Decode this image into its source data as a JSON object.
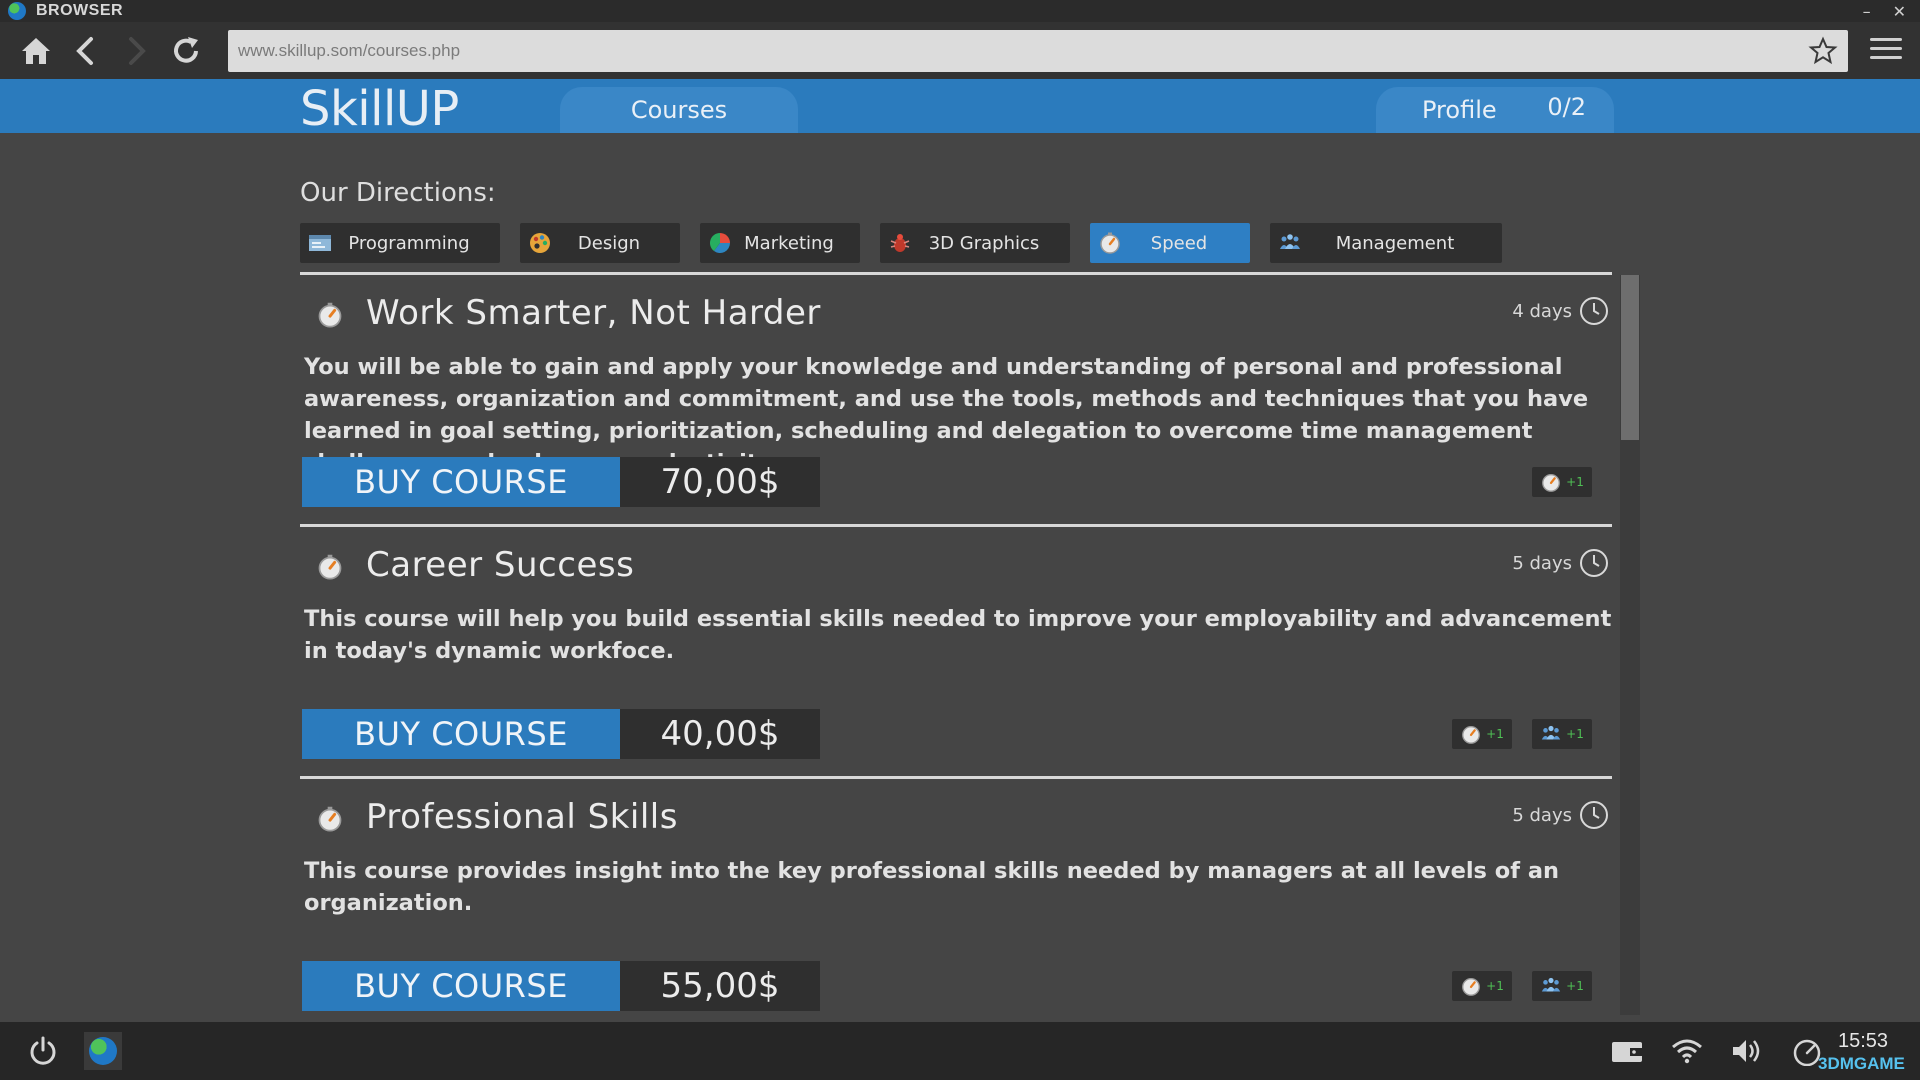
{
  "window": {
    "title": "BROWSER",
    "minimize": "–",
    "close": "✕"
  },
  "browser": {
    "url": "www.skillup.som/courses.php"
  },
  "site": {
    "logo": "SkillUP",
    "nav": {
      "courses": "Courses",
      "profile": "Profile",
      "profile_count": "0/2"
    }
  },
  "directions": {
    "title": "Our Directions:",
    "items": [
      {
        "label": "Programming",
        "icon": "programming-icon"
      },
      {
        "label": "Design",
        "icon": "palette-icon"
      },
      {
        "label": "Marketing",
        "icon": "pie-chart-icon"
      },
      {
        "label": "3D Graphics",
        "icon": "3d-graphics-icon"
      },
      {
        "label": "Speed",
        "icon": "stopwatch-icon",
        "active": true
      },
      {
        "label": "Management",
        "icon": "people-icon"
      }
    ]
  },
  "courses": [
    {
      "title": "Work Smarter, Not Harder",
      "duration": "4 days",
      "description": "You will be able to gain and apply your knowledge and understanding of personal and professional awareness, organization and commitment, and use the tools, methods and techniques that you have learned in goal setting, prioritization, scheduling and delegation to overcome time management challenges and enhance productivity.",
      "buy_label": "BUY COURSE",
      "price": "70,00$",
      "rewards": [
        {
          "icon": "stopwatch-icon",
          "text": "+1"
        }
      ]
    },
    {
      "title": "Career Success",
      "duration": "5 days",
      "description": "This course will help you build essential skills needed to improve your employability and advancement in today's dynamic workfoce.",
      "buy_label": "BUY COURSE",
      "price": "40,00$",
      "rewards": [
        {
          "icon": "stopwatch-icon",
          "text": "+1"
        },
        {
          "icon": "people-icon",
          "text": "+1"
        }
      ]
    },
    {
      "title": "Professional Skills",
      "duration": "5 days",
      "description": "This course provides insight into the key professional skills needed by managers at all levels of an organization.",
      "buy_label": "BUY COURSE",
      "price": "55,00$",
      "rewards": [
        {
          "icon": "stopwatch-icon",
          "text": "+1"
        },
        {
          "icon": "people-icon",
          "text": "+1"
        }
      ]
    }
  ],
  "taskbar": {
    "time": "15:53",
    "watermark": "3DMGAME"
  },
  "colors": {
    "brand_blue": "#2b7bbd",
    "active_tab": "#2e7fc4",
    "reward_green": "#4fbf55"
  }
}
